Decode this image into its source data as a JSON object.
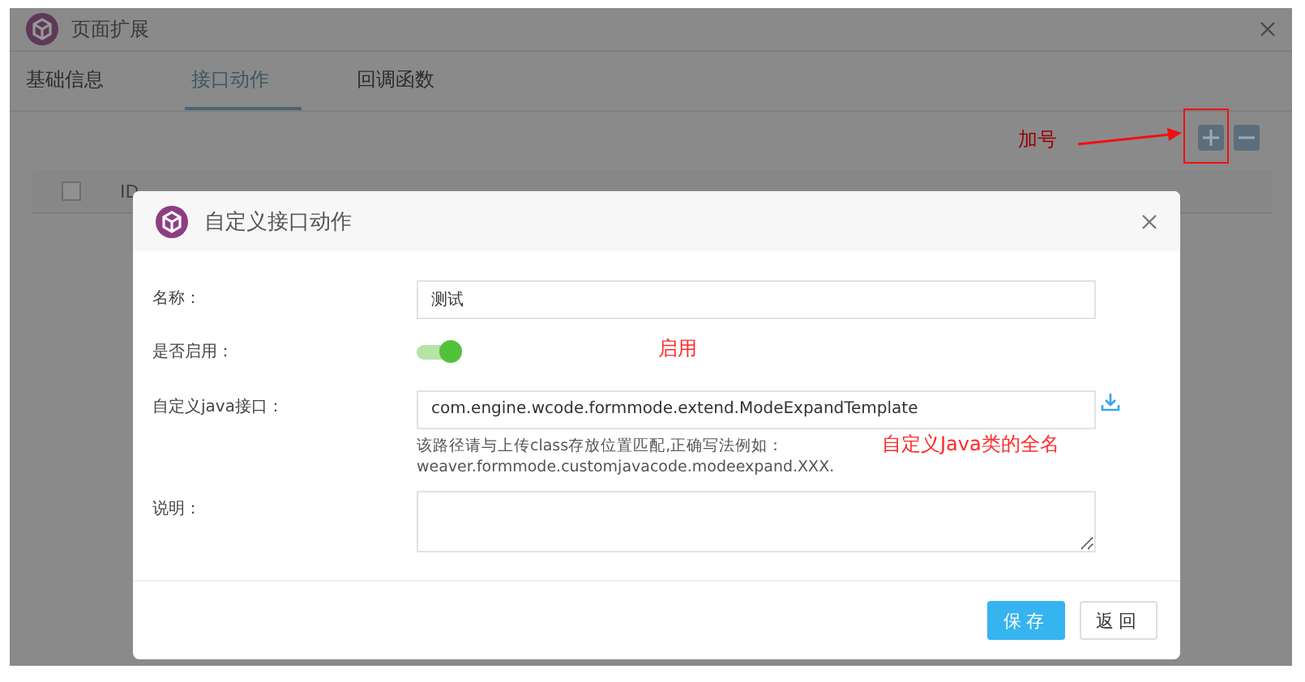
{
  "window": {
    "title": "页面扩展"
  },
  "tabs": [
    {
      "label": "基础信息",
      "selected": false
    },
    {
      "label": "接口动作",
      "selected": true
    },
    {
      "label": "回调函数",
      "selected": false
    }
  ],
  "table": {
    "select_all_checked": false,
    "columns": [
      "ID"
    ]
  },
  "dialog": {
    "title": "自定义接口动作",
    "fields": [
      {
        "kind": "text",
        "label": "名称：",
        "value": "测试"
      },
      {
        "kind": "switch",
        "label": "是否启用：",
        "on": true
      },
      {
        "kind": "class",
        "label": "自定义java接口：",
        "value": "com.engine.wcode.formmode.extend.ModeExpandTemplate",
        "hint": [
          "该路径请与上传class存放位置匹配,正确写法例如：",
          "weaver.formmode.customjavacode.modeexpand.XXX."
        ]
      },
      {
        "kind": "textarea",
        "label": "说明："
      }
    ],
    "buttons": [
      "保存",
      "返回"
    ]
  },
  "annotations": [
    {
      "kind": "plus",
      "text": "加号"
    },
    {
      "kind": "enable",
      "text": "启用"
    },
    {
      "kind": "class",
      "text": "自定义Java类的全名"
    }
  ]
}
